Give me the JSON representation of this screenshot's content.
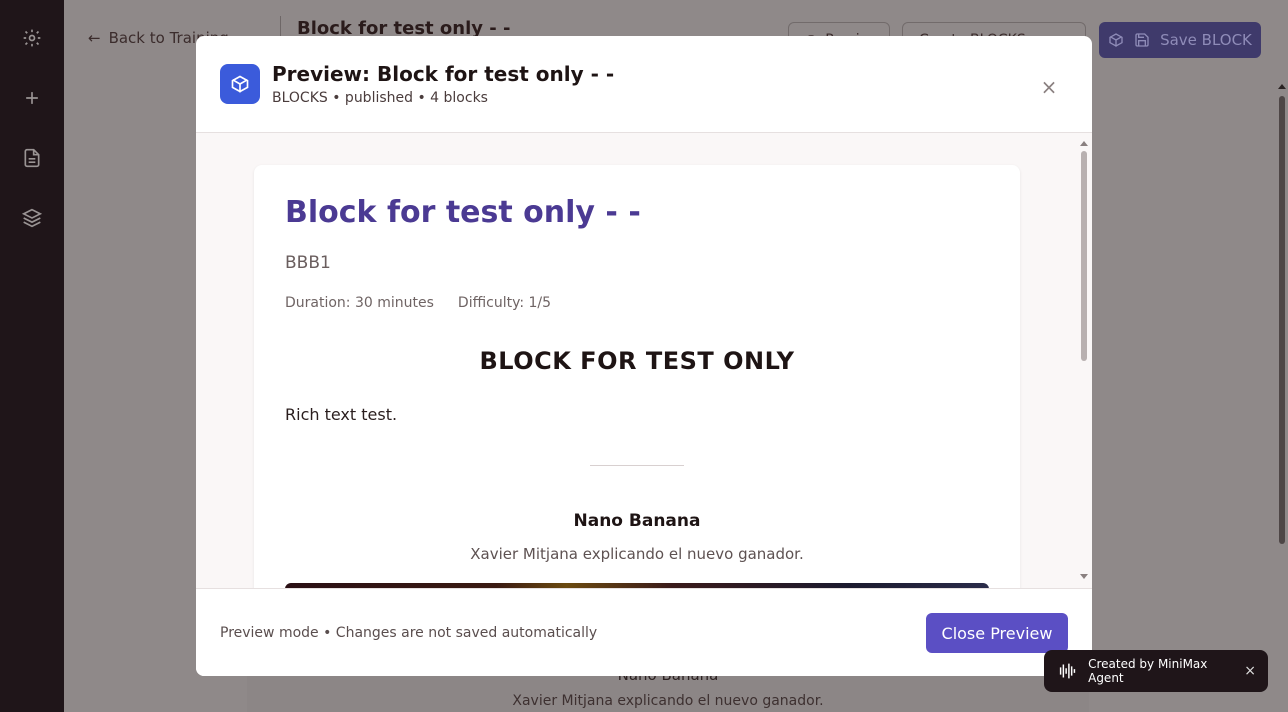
{
  "topbar": {
    "back_label": "Back to Training",
    "page_title": "Block for test only - -",
    "preview_label": "Preview",
    "create_label": "Create BLOCKS",
    "save_label": "Save BLOCK"
  },
  "modal": {
    "title": "Preview: Block for test only - -",
    "meta": "BLOCKS • published • 4 blocks",
    "close_glyph": "×",
    "footer_note": "Preview mode • Changes are not saved automatically",
    "close_button": "Close Preview"
  },
  "preview": {
    "block_title": "Block for test only - -",
    "subtitle": "BBB1",
    "duration": "Duration: 30 minutes",
    "difficulty": "Difficulty: 1/5",
    "heading": "BLOCK FOR TEST ONLY",
    "rich_text": "Rich text test.",
    "item_title": "Nano Banana",
    "item_subtitle": "Xavier Mitjana explicando el nuevo ganador."
  },
  "background": {
    "item_title": "Nano Banana",
    "item_subtitle": "Xavier Mitjana explicando el nuevo ganador."
  },
  "toast": {
    "text": "Created by MiniMax Agent",
    "close_glyph": "×"
  },
  "icons": {
    "rail": [
      "gear-icon",
      "plus-icon",
      "document-icon",
      "layers-icon"
    ],
    "modal": "cube-icon",
    "save": "save-icon"
  },
  "colors": {
    "accent": "#5b4fc4",
    "title_purple": "#4b3a93",
    "modal_icon_bg": "#3b5bdb",
    "rail_bg": "#1f1519"
  }
}
